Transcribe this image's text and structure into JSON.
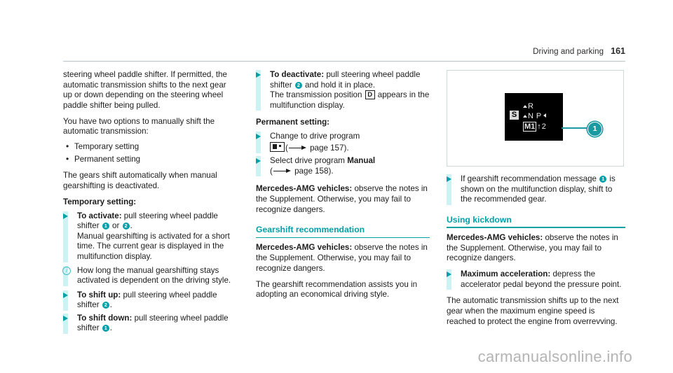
{
  "header": {
    "title": "Driving and parking",
    "page_number": "161"
  },
  "column1": {
    "para_1": "steering wheel paddle shifter. If permitted, the automatic transmission shifts to the next gear up or down depending on the steering wheel paddle shifter being pulled.",
    "para_2": "You have two options to manually shift the automatic transmission:",
    "options": [
      "Temporary setting",
      "Permanent setting"
    ],
    "para_3": "The gears shift automatically when manual gearshifting is deactivated.",
    "temporary_heading": "Temporary setting:",
    "activate": {
      "lead": "To activate:",
      "text_a": " pull steering wheel paddle shifter ",
      "badge_1": "1",
      "text_b": " or ",
      "badge_2": "2",
      "text_c": ".",
      "detail": "Manual gearshifting is activated for a short time. The current gear is displayed in the multifunction display."
    },
    "note": {
      "icon": "info-icon",
      "text": "How long the manual gearshifting stays activated is dependent on the driving style."
    },
    "shift_up": {
      "lead": "To shift up:",
      "text_a": " pull steering wheel paddle shifter ",
      "badge": "2",
      "text_b": "."
    },
    "shift_down": {
      "lead": "To shift down:",
      "text_a": " pull steering wheel paddle shifter ",
      "badge": "1",
      "text_b": "."
    }
  },
  "column2": {
    "deactivate": {
      "lead": "To deactivate:",
      "text_a": " pull steering wheel paddle shifter ",
      "badge": "2",
      "text_b": " and hold it in place.",
      "detail_a": "The transmission position ",
      "detail_glyph": "D",
      "detail_b": " appears in the multifunction display."
    },
    "permanent_heading": "Permanent setting:",
    "change_program": {
      "text_a": "Change to drive program",
      "icon": "drive-program-icon",
      "ref_open": "(",
      "ref_arrow": "arrow-right-icon",
      "ref_text": " page 157)."
    },
    "select_program": {
      "text_a": "Select drive program ",
      "bold": "Manual",
      "ref_open": "(",
      "ref_arrow": "arrow-right-icon",
      "ref_text": " page 158)."
    },
    "amg_note": {
      "lead": "Mercedes-AMG vehicles:",
      "text": " observe the notes in the Supplement. Otherwise, you may fail to recognize dangers."
    },
    "section": {
      "title": "Gearshift recommendation"
    },
    "amg_note_2": {
      "lead": "Mercedes-AMG vehicles:",
      "text": " observe the notes in the Supplement. Otherwise, you may fail to recognize dangers."
    },
    "para_final": "The gearshift recommendation assists you in adopting an economical driving style."
  },
  "column3": {
    "figure": {
      "alt": "multifunction-display-gearshift-recommendation",
      "display": {
        "s_indicator": "S",
        "row_reverse": "R",
        "row_neutral": "N",
        "row_park": "P",
        "row_manual_gear": "M1",
        "row_recommended": "2",
        "up_arrow": "↑"
      },
      "callout_number": "1"
    },
    "instruction": {
      "text_a": "If gearshift recommendation message ",
      "badge": "1",
      "text_b": " is shown on the multifunction display, shift to the recommended gear."
    },
    "section": {
      "title": "Using kickdown"
    },
    "amg_note": {
      "lead": "Mercedes-AMG vehicles:",
      "text": " observe the notes in the Supplement. Otherwise, you may fail to recognize dangers."
    },
    "max_accel": {
      "lead": "Maximum acceleration:",
      "text": " depress the accelerator pedal beyond the pressure point."
    },
    "para_final": "The automatic transmission shifts up to the next gear when the maximum engine speed is reached to protect the engine from overrevving."
  },
  "watermark": "carmanualsonline.info",
  "colors": {
    "accent": "#00a0a8",
    "accent_bar": "#ccf2f3",
    "callout": "#1b9aa2",
    "rule": "#b9c2c4"
  }
}
